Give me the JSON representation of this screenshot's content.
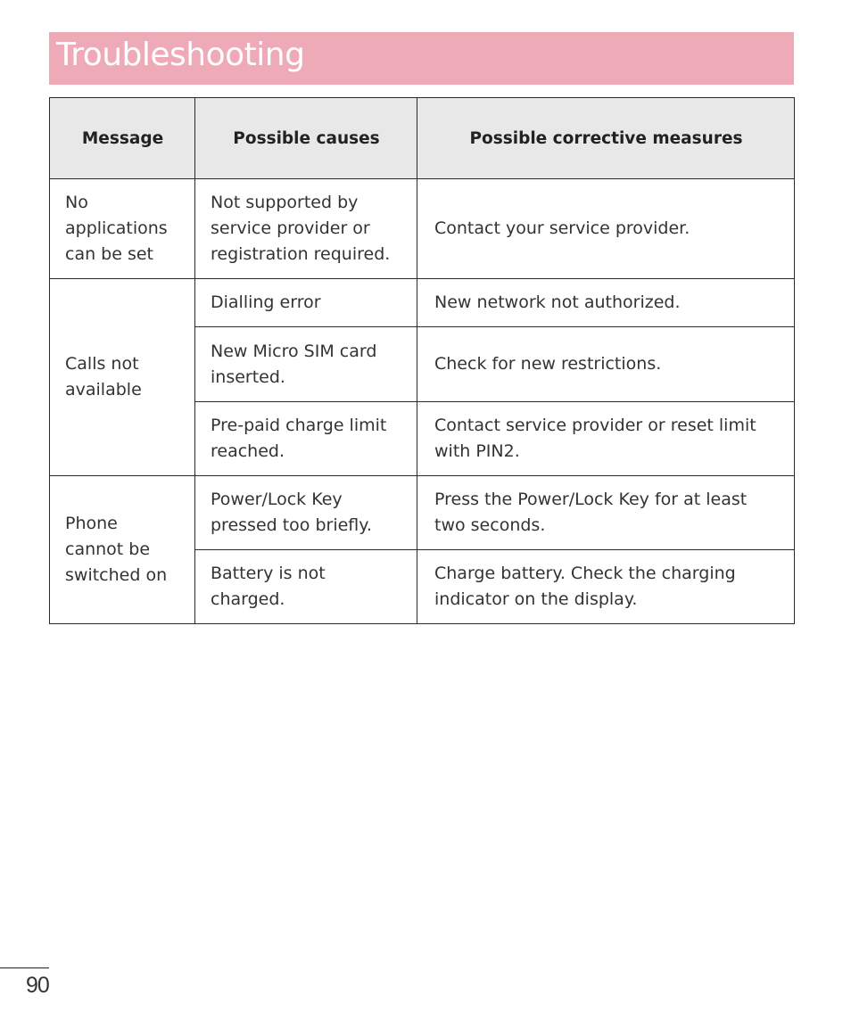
{
  "section_title": "Troubleshooting",
  "table": {
    "headers": [
      "Message",
      "Possible causes",
      "Possible corrective measures"
    ],
    "groups": [
      {
        "message": "No applications can be set",
        "rows": [
          {
            "cause": "Not supported by service provider or registration required.",
            "measure": "Contact your service provider."
          }
        ]
      },
      {
        "message": "Calls not available",
        "rows": [
          {
            "cause": "Dialling error",
            "measure": "New network not authorized."
          },
          {
            "cause": "New Micro SIM card inserted.",
            "measure": "Check for new restrictions."
          },
          {
            "cause": "Pre-paid charge limit reached.",
            "measure": "Contact service provider or reset limit with PIN2."
          }
        ]
      },
      {
        "message": "Phone cannot be switched on",
        "rows": [
          {
            "cause": "Power/Lock Key pressed too briefly.",
            "measure": "Press the Power/Lock Key for at least two seconds."
          },
          {
            "cause": "Battery is not charged.",
            "measure": "Charge battery. Check the charging indicator on the display."
          }
        ]
      }
    ]
  },
  "page_number": "90"
}
